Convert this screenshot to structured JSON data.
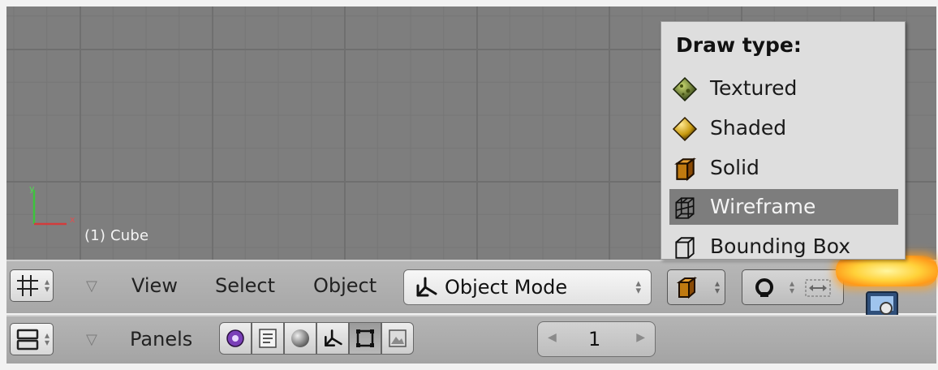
{
  "viewport": {
    "object_label": "(1) Cube",
    "axis_x_label": "x",
    "axis_y_label": "y"
  },
  "header": {
    "menus": [
      "View",
      "Select",
      "Object"
    ],
    "mode": "Object Mode"
  },
  "draw_type_menu": {
    "title": "Draw type:",
    "items": [
      {
        "label": "Textured",
        "icon": "textured-icon",
        "selected": false
      },
      {
        "label": "Shaded",
        "icon": "shaded-icon",
        "selected": false
      },
      {
        "label": "Solid",
        "icon": "solid-icon",
        "selected": false
      },
      {
        "label": "Wireframe",
        "icon": "wireframe-icon",
        "selected": true
      },
      {
        "label": "Bounding Box",
        "icon": "bounding-box-icon",
        "selected": false
      }
    ]
  },
  "buttons_window": {
    "panels_label": "Panels",
    "frame_value": "1",
    "context_buttons": [
      "logic-icon",
      "script-icon",
      "shading-icon",
      "object-icon",
      "editing-icon",
      "scene-icon"
    ],
    "active_context_index": 4
  },
  "colors": {
    "viewport_bg": "#7e7e7e",
    "menu_highlight": "#7d7d7d",
    "axis_x": "#d23c3c",
    "axis_y": "#3cc43c",
    "glow": "#ffb020"
  }
}
